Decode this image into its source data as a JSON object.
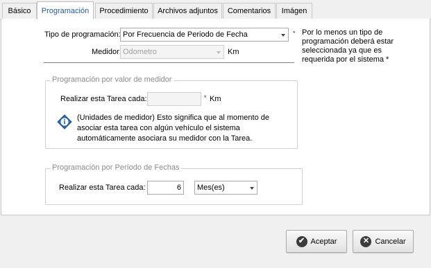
{
  "tabs": [
    {
      "label": "Básico"
    },
    {
      "label": "Programación"
    },
    {
      "label": "Procedimiento"
    },
    {
      "label": "Archivos adjuntos"
    },
    {
      "label": "Comentarios"
    },
    {
      "label": "Imágen"
    }
  ],
  "form": {
    "tipo_label": "Tipo de programación:",
    "tipo_value": "Por Frecuencia de Periodo de Fecha",
    "required_mark": "*",
    "required_note": "Por lo menos un tipo de programación deberá estar seleccionada ya que es requerida por el sistema *",
    "medidor_label": "Medidor:",
    "medidor_value": "Odometro",
    "medidor_unit": "Km"
  },
  "group_meter": {
    "title": "Programación por valor de medidor",
    "task_label": "Realizar esta Tarea cada:",
    "task_value": "",
    "required_mark": "*",
    "unit": "Km",
    "info_text": "(Unidades de medidor) Esto significa que al momento de asociar esta tarea con algún vehículo el sistema automáticamente asociara su medidor con la Tarea."
  },
  "group_date": {
    "title": "Programación por Período de Fechas",
    "task_label": "Realizar esta Tarea cada:",
    "task_value": "6",
    "period_value": "Mes(es)"
  },
  "buttons": {
    "accept_label": "Aceptar",
    "cancel_label": "Cancelar"
  },
  "colors": {
    "active_tab_text": "#1e5aa8",
    "info_icon": "#2f6db5"
  }
}
